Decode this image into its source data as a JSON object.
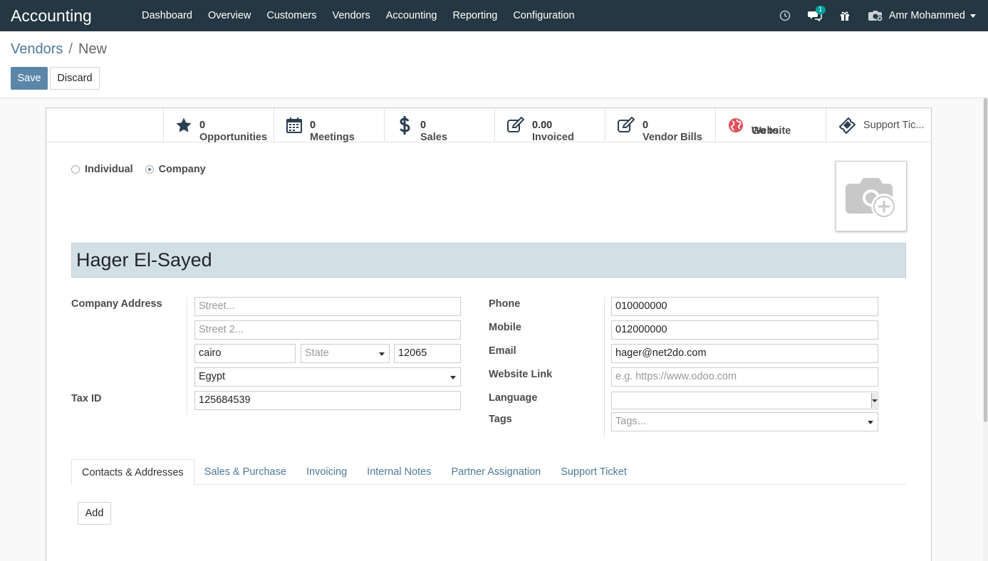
{
  "app": {
    "title": "Accounting"
  },
  "navbar": {
    "menu": [
      "Dashboard",
      "Overview",
      "Customers",
      "Vendors",
      "Accounting",
      "Reporting",
      "Configuration"
    ],
    "messages_badge": "1",
    "user_name": "Amr Mohammed"
  },
  "breadcrumb": {
    "parent": "Vendors",
    "separator": "/",
    "current": "New"
  },
  "actions": {
    "save": "Save",
    "discard": "Discard"
  },
  "smart_buttons": [
    {
      "icon": "star-icon",
      "value": "0",
      "label": "Opportunities"
    },
    {
      "icon": "calendar-icon",
      "value": "0",
      "label": "Meetings"
    },
    {
      "icon": "dollar-icon",
      "value": "0",
      "label": "Sales"
    },
    {
      "icon": "edit-icon",
      "value": "0.00",
      "label": "Invoiced"
    },
    {
      "icon": "edit-icon",
      "value": "0",
      "label": "Vendor Bills"
    },
    {
      "icon": "globe-icon",
      "value": "Go to",
      "label": "Website"
    },
    {
      "icon": "ticket-icon",
      "label": "Support Tic..."
    }
  ],
  "company_type": {
    "options": [
      "Individual",
      "Company"
    ],
    "selected": "Company"
  },
  "partner_name": "Hager El-Sayed",
  "address": {
    "label": "Company Address",
    "street_placeholder": "Street...",
    "street2_placeholder": "Street 2...",
    "city": "cairo",
    "state_placeholder": "State",
    "zip": "12065",
    "country": "Egypt"
  },
  "tax": {
    "label": "Tax ID",
    "value": "125684539"
  },
  "contact": {
    "phone_label": "Phone",
    "phone": "010000000",
    "mobile_label": "Mobile",
    "mobile": "012000000",
    "email_label": "Email",
    "email": "hager@net2do.com",
    "website_label": "Website Link",
    "website_placeholder": "e.g. https://www.odoo.com",
    "language_label": "Language",
    "language": "",
    "tags_label": "Tags",
    "tags_placeholder": "Tags..."
  },
  "tabs": [
    "Contacts & Addresses",
    "Sales & Purchase",
    "Invoicing",
    "Internal Notes",
    "Partner Assignation",
    "Support Ticket"
  ],
  "active_tab": "Contacts & Addresses",
  "add_button": "Add",
  "colors": {
    "navbar": "#243742",
    "primary": "#5b86a8",
    "link": "#4c7a99",
    "name_bg": "#d2dfe7"
  }
}
